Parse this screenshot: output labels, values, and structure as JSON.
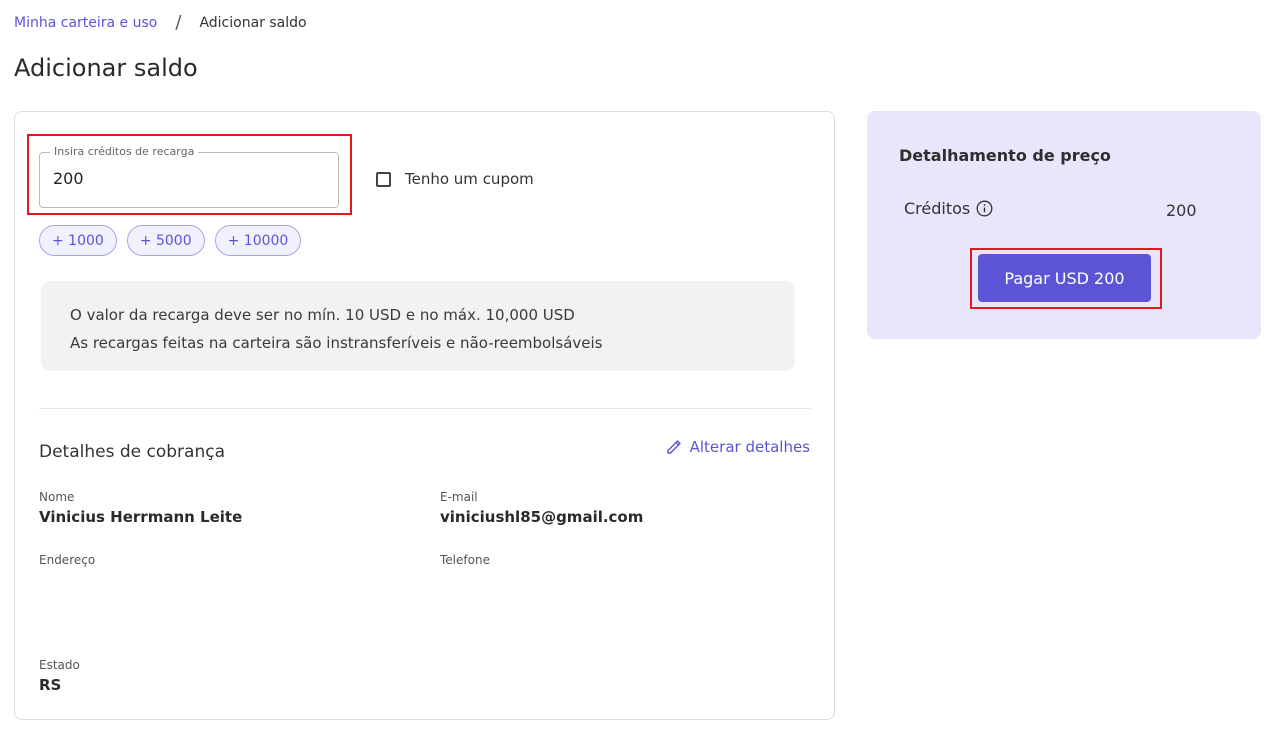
{
  "breadcrumb": {
    "parent": "Minha carteira e uso",
    "separator": "/",
    "current": "Adicionar saldo"
  },
  "page": {
    "title": "Adicionar saldo"
  },
  "recharge": {
    "legend": "Insira créditos de recarga",
    "value": "200",
    "coupon_label": "Tenho um cupom",
    "coupon_checked": false,
    "chips": [
      "+ 1000",
      "+ 5000",
      "+ 10000"
    ],
    "info_lines": [
      "O valor da recarga deve ser no mín. 10 USD e no máx. 10,000 USD",
      "As recargas feitas na carteira são instransferíveis e não-reembolsáveis"
    ]
  },
  "billing": {
    "title": "Detalhes de cobrança",
    "edit_label": "Alterar detalhes",
    "name_label": "Nome",
    "name_value": "Vinicius Herrmann Leite",
    "email_label": "E-mail",
    "email_value": "viniciushl85@gmail.com",
    "address_label": "Endereço",
    "address_value": "",
    "phone_label": "Telefone",
    "phone_value": "",
    "state_label": "Estado",
    "state_value": "RS"
  },
  "price": {
    "title": "Detalhamento de preço",
    "credits_label": "Créditos",
    "credits_value": "200",
    "pay_button": "Pagar USD 200"
  },
  "colors": {
    "accent": "#5b55d6",
    "side_panel": "#e7e6fb",
    "highlight": "#e01818"
  },
  "icons": {
    "info": "info-icon",
    "edit": "pencil-icon",
    "checkbox": "checkbox-icon"
  }
}
